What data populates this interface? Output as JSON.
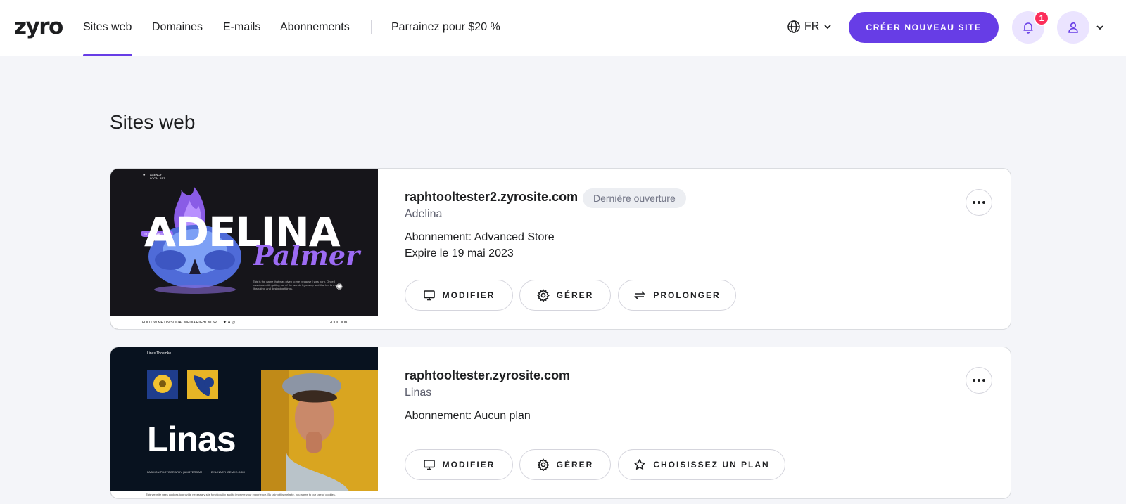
{
  "header": {
    "logo": "zyro",
    "nav": [
      {
        "label": "Sites web",
        "active": true
      },
      {
        "label": "Domaines"
      },
      {
        "label": "E-mails"
      },
      {
        "label": "Abonnements"
      },
      {
        "label": "Parrainez pour $20 %"
      }
    ],
    "language": "FR",
    "create_label": "CRÉER NOUVEAU SITE",
    "notification_count": "1",
    "accent_color": "#673de6"
  },
  "page": {
    "title": "Sites web"
  },
  "sites": [
    {
      "domain": "raphtooltester2.zyrosite.com",
      "tag": "Dernière ouverture",
      "name": "Adelina",
      "subscription": "Abonnement: Advanced Store",
      "expiry": "Expire le 19 mai 2023",
      "actions": [
        {
          "label": "MODIFIER",
          "icon": "monitor-icon"
        },
        {
          "label": "GÉRER",
          "icon": "gear-icon"
        },
        {
          "label": "PROLONGER",
          "icon": "renew-icon"
        }
      ],
      "preview": {
        "title": "ADELINA",
        "subtitle": "Palmer",
        "logo_text": "AGENCY LOCAL ART",
        "body": "This is the name that was given to me because I was born. Once I was done with getting out of the womb, I grew up and that led to me illustrating and designing things.",
        "footer_left": "FOLLOW ME ON SOCIAL MEDIA RIGHT NOW!",
        "footer_right": "GOOD JOB"
      }
    },
    {
      "domain": "raphtooltester.zyrosite.com",
      "name": "Linas",
      "subscription": "Abonnement: Aucun plan",
      "actions": [
        {
          "label": "MODIFIER",
          "icon": "monitor-icon"
        },
        {
          "label": "GÉRER",
          "icon": "gear-icon"
        },
        {
          "label": "CHOISISSEZ UN PLAN",
          "icon": "star-icon"
        }
      ],
      "preview": {
        "title": "Linas",
        "name": "Linas Thoemke",
        "footer_left": "FASHION PHOTOGRAPHY | AMSTERDAM",
        "footer_right": "BY.LINASTHOEMKE.COM",
        "cookie": "This website uses cookies to provide necessary site functionality and to improve your experience. By using this website, you agree to our use of cookies."
      }
    }
  ]
}
